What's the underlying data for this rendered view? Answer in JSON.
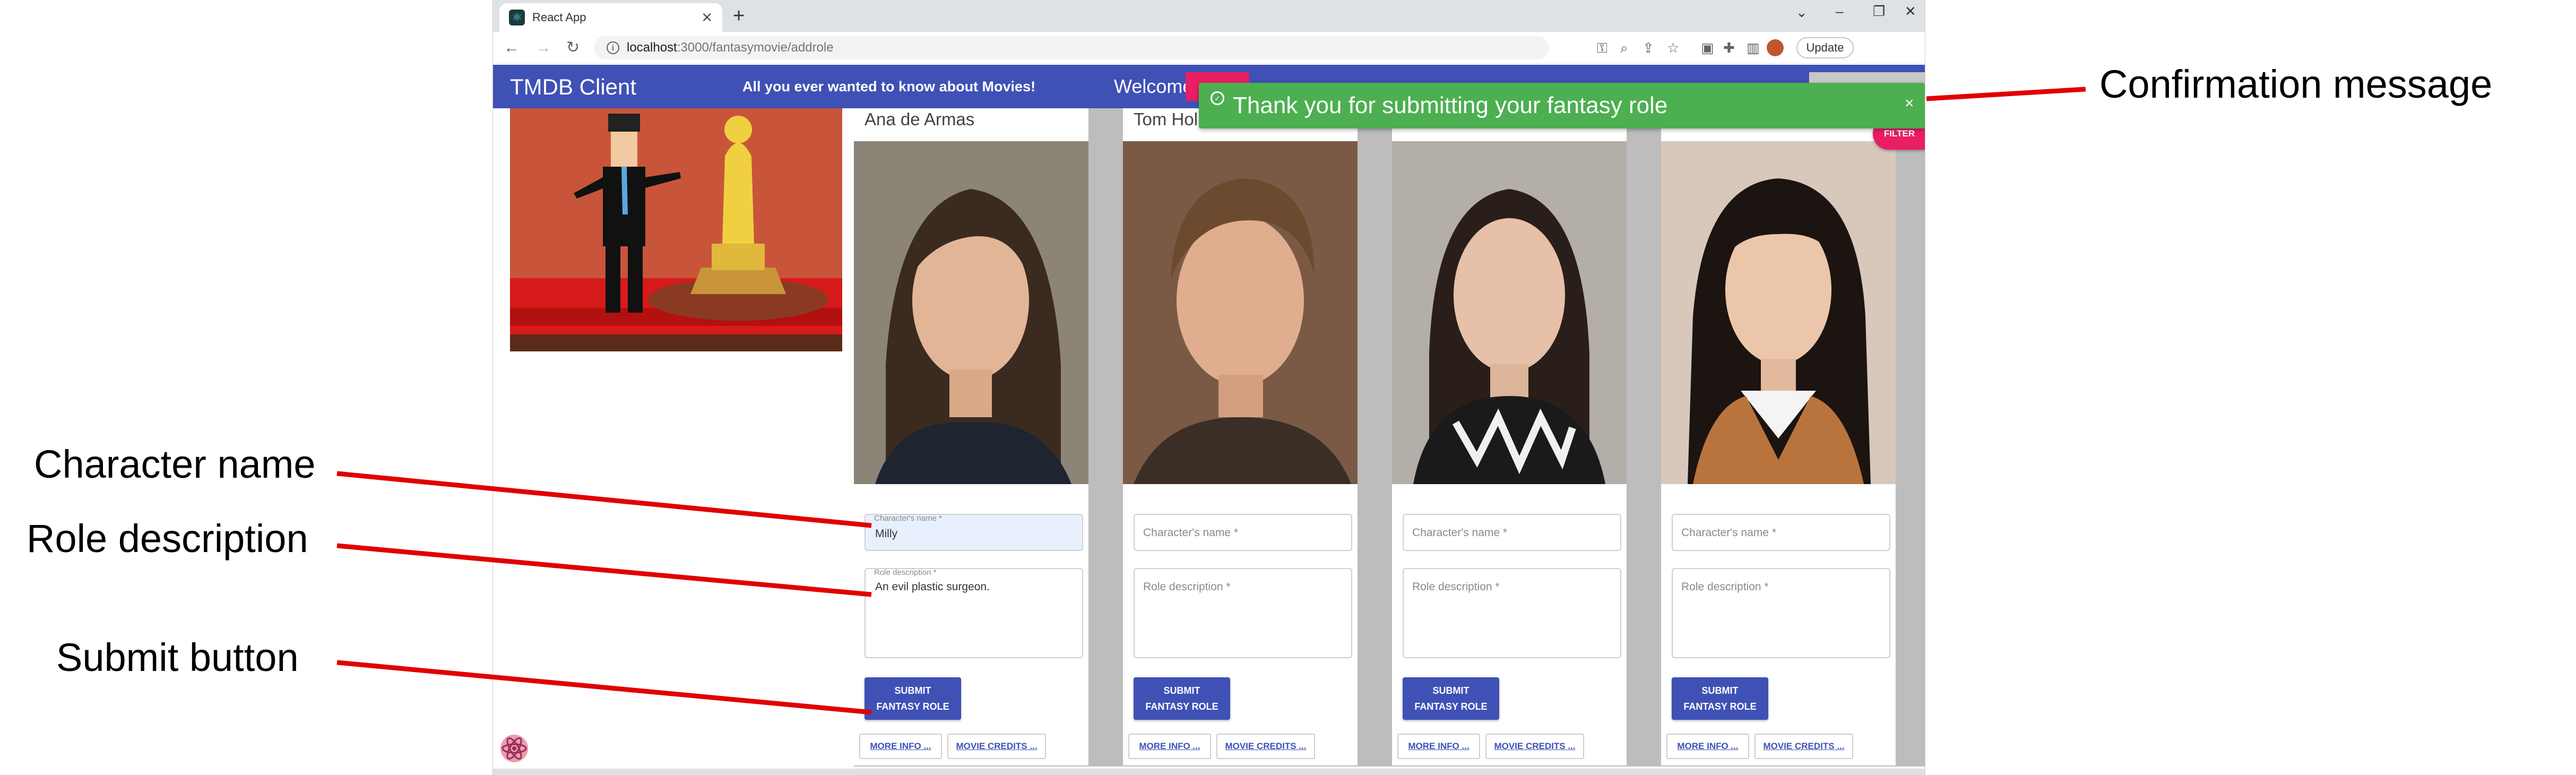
{
  "browser": {
    "tab_title": "React App",
    "new_tab": "+",
    "url_host": "localhost",
    "url_path": ":3000/fantasymovie/addrole",
    "update_label": "Update"
  },
  "app": {
    "title": "TMDB Client",
    "tagline": "All you ever wanted to know about Movies!",
    "welcome": "Welcome!",
    "filter_label": "FILTER"
  },
  "snackbar": {
    "message": "Thank you for submitting your fantasy role",
    "close": "×"
  },
  "form": {
    "character_label": "Character's name *",
    "description_label": "Role description *",
    "submit_line1": "SUBMIT",
    "submit_line2": "FANTASY ROLE",
    "more_info": "MORE INFO ...",
    "movie_credits": "MOVIE CREDITS ..."
  },
  "cards": [
    {
      "name": "Ana de Armas",
      "character": "Milly",
      "description": "An evil plastic surgeon."
    },
    {
      "name": "Tom Holland",
      "character": "",
      "description": ""
    },
    {
      "name": "",
      "character": "",
      "description": ""
    },
    {
      "name": "",
      "character": "",
      "description": ""
    }
  ],
  "annotations": {
    "confirmation": "Confirmation message",
    "character_name": "Character name",
    "role_description": "Role description",
    "submit_button": "Submit button"
  },
  "colors": {
    "app_bar": "#3f51b5",
    "accent_pink": "#e91e63",
    "snackbar_green": "#4caf50",
    "annotation_line": "#e00000"
  }
}
